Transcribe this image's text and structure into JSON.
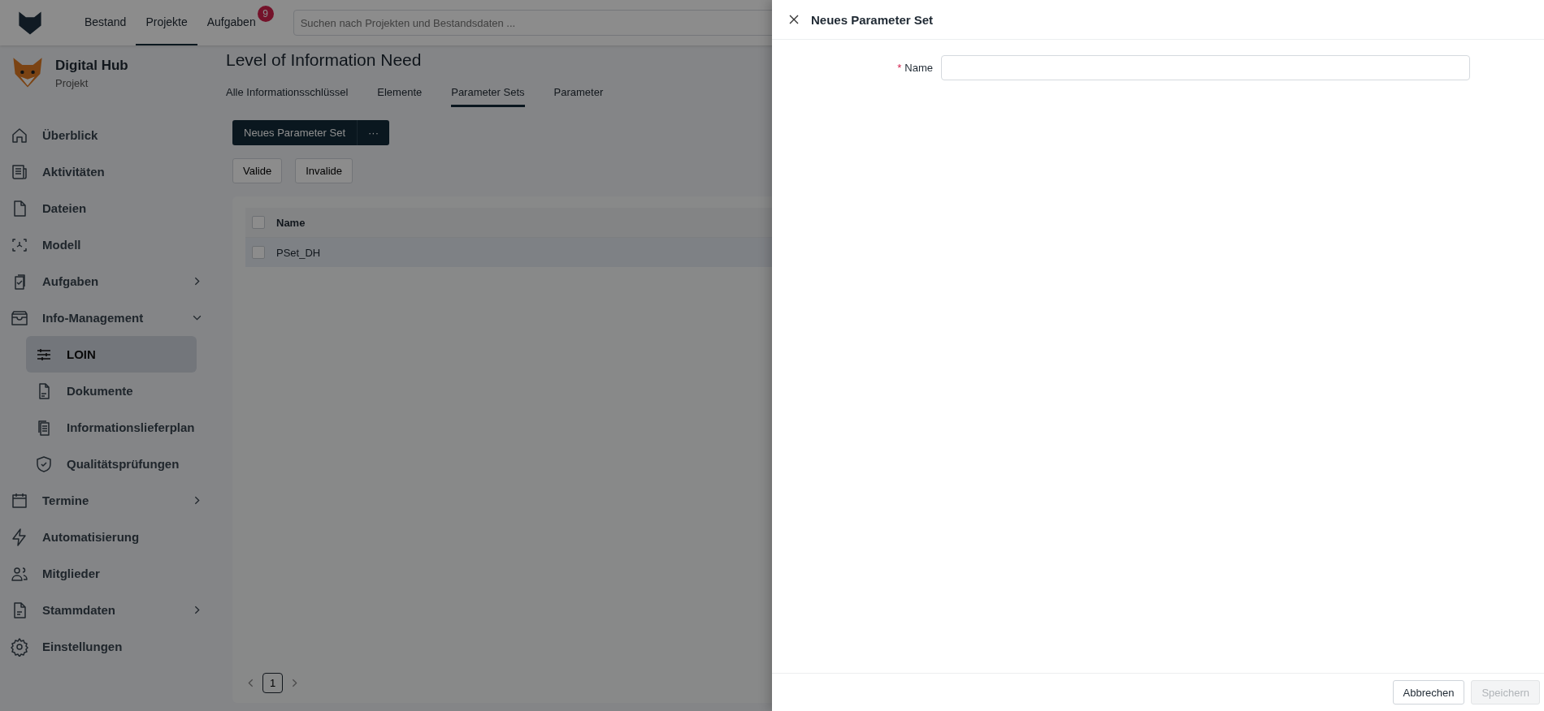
{
  "topbar": {
    "nav": [
      {
        "label": "Bestand",
        "selected": false
      },
      {
        "label": "Projekte",
        "selected": true
      },
      {
        "label": "Aufgaben",
        "selected": false,
        "badge": "9"
      }
    ],
    "search": {
      "placeholder": "Suchen nach Projekten und Bestandsdaten ..."
    }
  },
  "project": {
    "name": "Digital Hub",
    "type": "Projekt"
  },
  "sidebar": {
    "items": [
      {
        "label": "Überblick",
        "kind": "link",
        "selected": false
      },
      {
        "label": "Aktivitäten",
        "kind": "link",
        "selected": false
      },
      {
        "label": "Dateien",
        "kind": "link",
        "selected": false
      },
      {
        "label": "Modell",
        "kind": "link",
        "selected": false
      },
      {
        "label": "Aufgaben",
        "kind": "group",
        "expanded": false,
        "selected": false
      },
      {
        "label": "Info-Management",
        "kind": "group",
        "expanded": true,
        "selected": false,
        "children": [
          {
            "label": "LOIN",
            "selected": true
          },
          {
            "label": "Dokumente",
            "selected": false
          },
          {
            "label": "Informationslieferplan",
            "selected": false
          },
          {
            "label": "Qualitätsprüfungen",
            "selected": false
          }
        ]
      },
      {
        "label": "Termine",
        "kind": "group",
        "expanded": false,
        "selected": false
      },
      {
        "label": "Automatisierung",
        "kind": "link",
        "selected": false
      },
      {
        "label": "Mitglieder",
        "kind": "link",
        "selected": false
      },
      {
        "label": "Stammdaten",
        "kind": "group",
        "expanded": false,
        "selected": false
      },
      {
        "label": "Einstellungen",
        "kind": "link",
        "selected": false
      }
    ]
  },
  "page": {
    "title": "Level of Information Need",
    "tabs": [
      {
        "label": "Alle Informationsschlüssel",
        "selected": false
      },
      {
        "label": "Elemente",
        "selected": false
      },
      {
        "label": "Parameter Sets",
        "selected": true
      },
      {
        "label": "Parameter",
        "selected": false
      }
    ],
    "primary_button": "Neues Parameter Set",
    "more_button": "···",
    "filters": [
      {
        "label": "Valide",
        "selected": false
      },
      {
        "label": "Invalide",
        "selected": false
      }
    ],
    "table": {
      "columns": [
        "Name"
      ],
      "header_checked": false,
      "rows": [
        {
          "name": "PSet_DH",
          "checked": false
        }
      ]
    },
    "pagination": {
      "pages": [
        {
          "label": "1",
          "selected": true
        }
      ]
    }
  },
  "drawer": {
    "title": "Neues Parameter Set",
    "fields": [
      {
        "label": "Name",
        "required_mark": "*"
      }
    ],
    "buttons": [
      {
        "label": "Abbrechen",
        "disabled": false
      },
      {
        "label": "Speichern",
        "disabled": true
      }
    ]
  }
}
